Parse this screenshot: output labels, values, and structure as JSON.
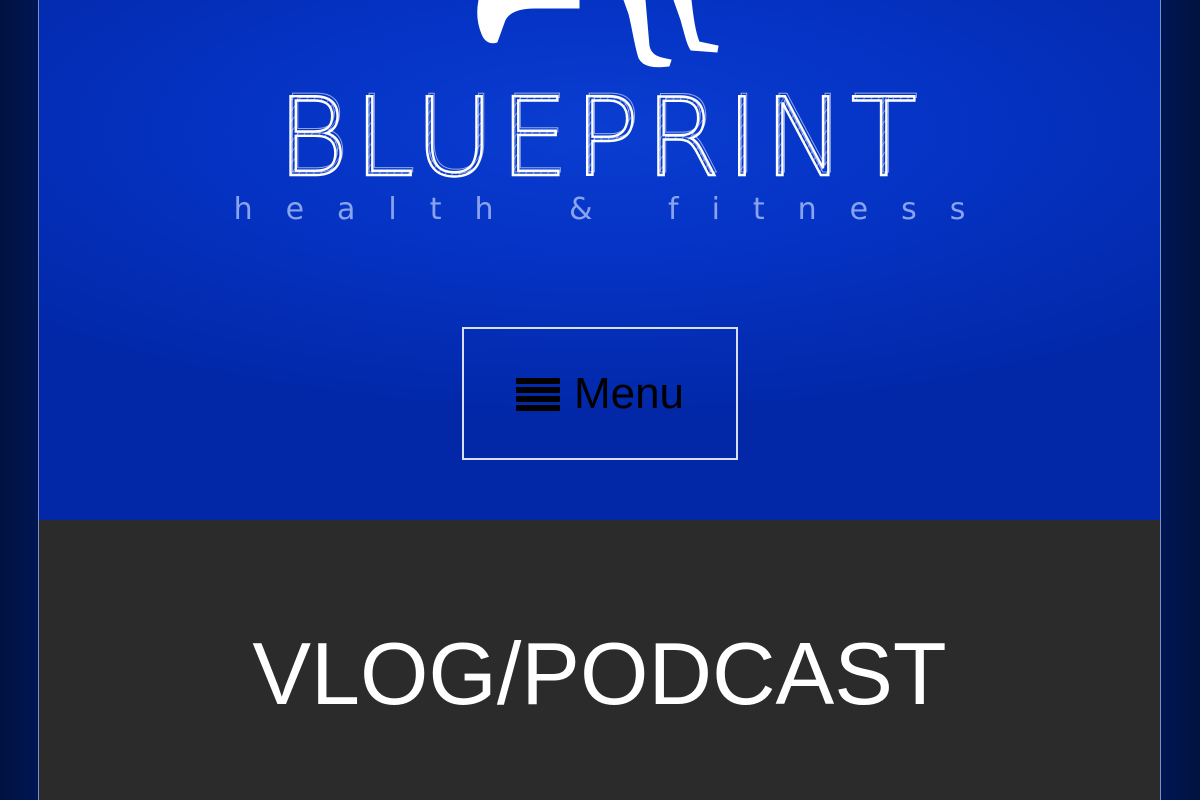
{
  "site": {
    "brand_name": "BLUEPRINT",
    "tagline": "health & fitness",
    "menu_button_label": "Menu",
    "menu_icon": "hamburger-icon",
    "logo_figure_icon": "pushup-figure-icon"
  },
  "main": {
    "page_title": "VLOG/PODCAST"
  },
  "colors": {
    "header_blue": "#0533c4",
    "content_dark": "#2b2b2b",
    "outer_navy": "#001654",
    "text_white": "#ffffff"
  }
}
